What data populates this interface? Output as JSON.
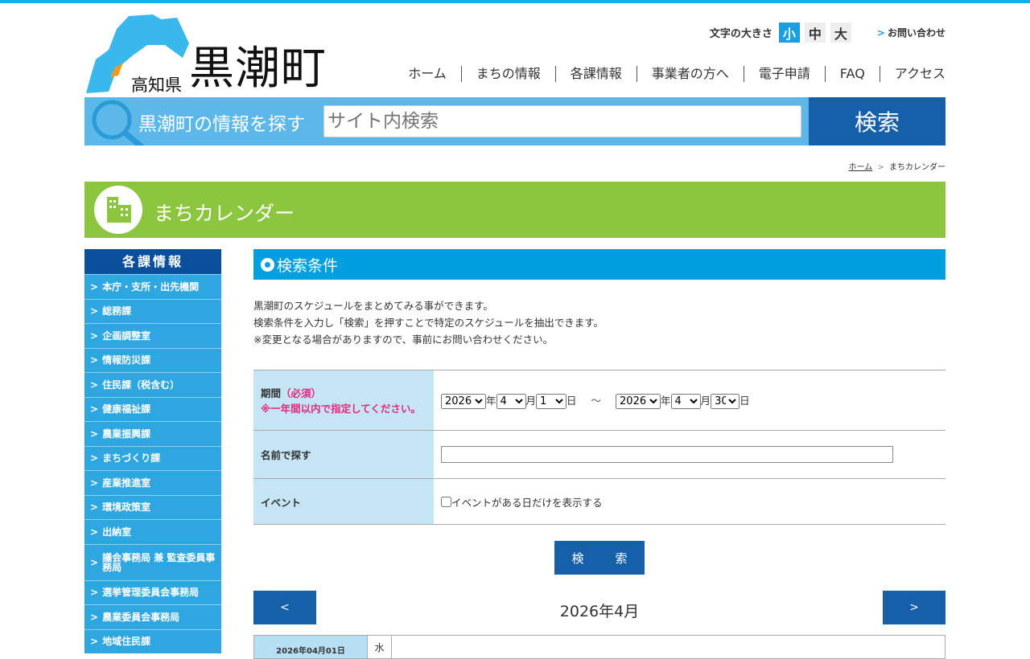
{
  "header": {
    "pref": "高知県",
    "town": "黒潮町",
    "font_size_label": "文字の大きさ",
    "font_sizes": [
      "小",
      "中",
      "大"
    ],
    "contact": "お問い合わせ",
    "nav": [
      "ホーム",
      "まちの情報",
      "各課情報",
      "事業者の方へ",
      "電子申請",
      "FAQ",
      "アクセス"
    ]
  },
  "search": {
    "label": "黒潮町の情報を探す",
    "placeholder": "サイト内検索",
    "button": "検索"
  },
  "breadcrumb": {
    "home": "ホーム",
    "sep": ">",
    "current": "まちカレンダー"
  },
  "banner": {
    "title": "まちカレンダー"
  },
  "sidebar": {
    "title": "各課情報",
    "items": [
      "本庁・支所・出先機関",
      "総務課",
      "企画調整室",
      "情報防災課",
      "住民課（税含む）",
      "健康福祉課",
      "農業振興課",
      "まちづくり課",
      "産業推進室",
      "環境政策室",
      "出納室",
      "議会事務局 兼 監査委員事務局",
      "選挙管理委員会事務局",
      "農業委員会事務局",
      "地域住民課"
    ]
  },
  "main": {
    "section_title": "検索条件",
    "desc": [
      "黒潮町のスケジュールをまとめてみる事ができます。",
      "検索条件を入力し「検索」を押すことで特定のスケジュールを抽出できます。",
      "※変更となる場合がありますので、事前にお問い合わせください。"
    ],
    "period": {
      "label": "期間",
      "required": "（必須）",
      "note": "※一年間以内で指定してください。",
      "from_year": "2026",
      "from_month": "4",
      "from_day": "1",
      "to_year": "2026",
      "to_month": "4",
      "to_day": "30",
      "year_u": "年",
      "month_u": "月",
      "day_u": "日",
      "tilde": "～"
    },
    "name": {
      "label": "名前で探す",
      "value": ""
    },
    "event": {
      "label": "イベント",
      "checkbox_label": "イベントがある日だけを表示する"
    },
    "search_button": "検　索",
    "cal": {
      "prev": "<",
      "next": ">",
      "title": "2026年4月",
      "first_date": "2026年04月01日",
      "first_weekday": "水"
    }
  },
  "colors": {
    "accent": "#00a0e0",
    "dark": "#1560a8",
    "green": "#8cc63f",
    "pink": "#e4287d"
  }
}
